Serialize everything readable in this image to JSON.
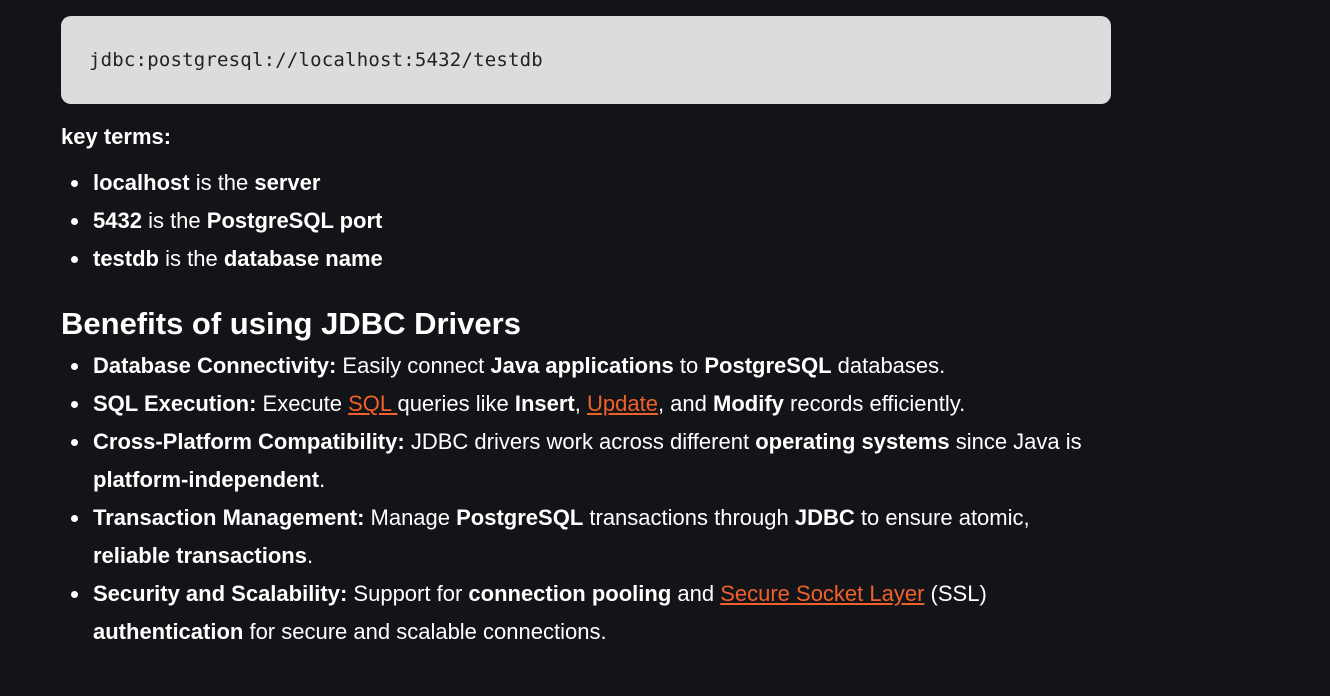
{
  "code": {
    "text": "jdbc:postgresql://localhost:5432/testdb"
  },
  "key_terms": {
    "heading": "key terms:",
    "items": [
      {
        "term": "localhost",
        "mid": " is the ",
        "value": "server"
      },
      {
        "term": "5432",
        "mid": " is the ",
        "value": "PostgreSQL port"
      },
      {
        "term": "testdb",
        "mid": " is the ",
        "value": "database name"
      }
    ]
  },
  "benefits": {
    "heading": "Benefits of using JDBC Drivers",
    "items": [
      {
        "label": "Database Connectivity:",
        "t1": " Easily connect ",
        "b1": "Java applications",
        "t2": " to ",
        "b2": "PostgreSQL",
        "t3": " databases."
      },
      {
        "label": "SQL Execution:",
        "t1": " Execute ",
        "link1": "SQL ",
        "t2": "queries like ",
        "b1": "Insert",
        "t3": ", ",
        "link2": "Update",
        "t4": ", and ",
        "b2": "Modify",
        "t5": " records efficiently."
      },
      {
        "label": "Cross-Platform Compatibility:",
        "t1": " JDBC drivers work across different ",
        "b1": "operating systems",
        "t2": " since Java is ",
        "b2": "platform-independent",
        "t3": "."
      },
      {
        "label": "Transaction Management:",
        "t1": " Manage ",
        "b1": "PostgreSQL",
        "t2": " transactions through ",
        "b2": "JDBC",
        "t3": " to ensure atomic, ",
        "b3": "reliable transactions",
        "t4": "."
      },
      {
        "label": "Security and Scalability:",
        "t1": " Support for ",
        "b1": "connection pooling",
        "t2": " and ",
        "link1": "Secure Socket Layer",
        "t3": " (SSL) ",
        "b2": "authentication",
        "t4": " for secure and scalable connections."
      }
    ]
  },
  "colors": {
    "background": "#131418",
    "code_background": "#dcdcdc",
    "link": "#f0602a"
  }
}
